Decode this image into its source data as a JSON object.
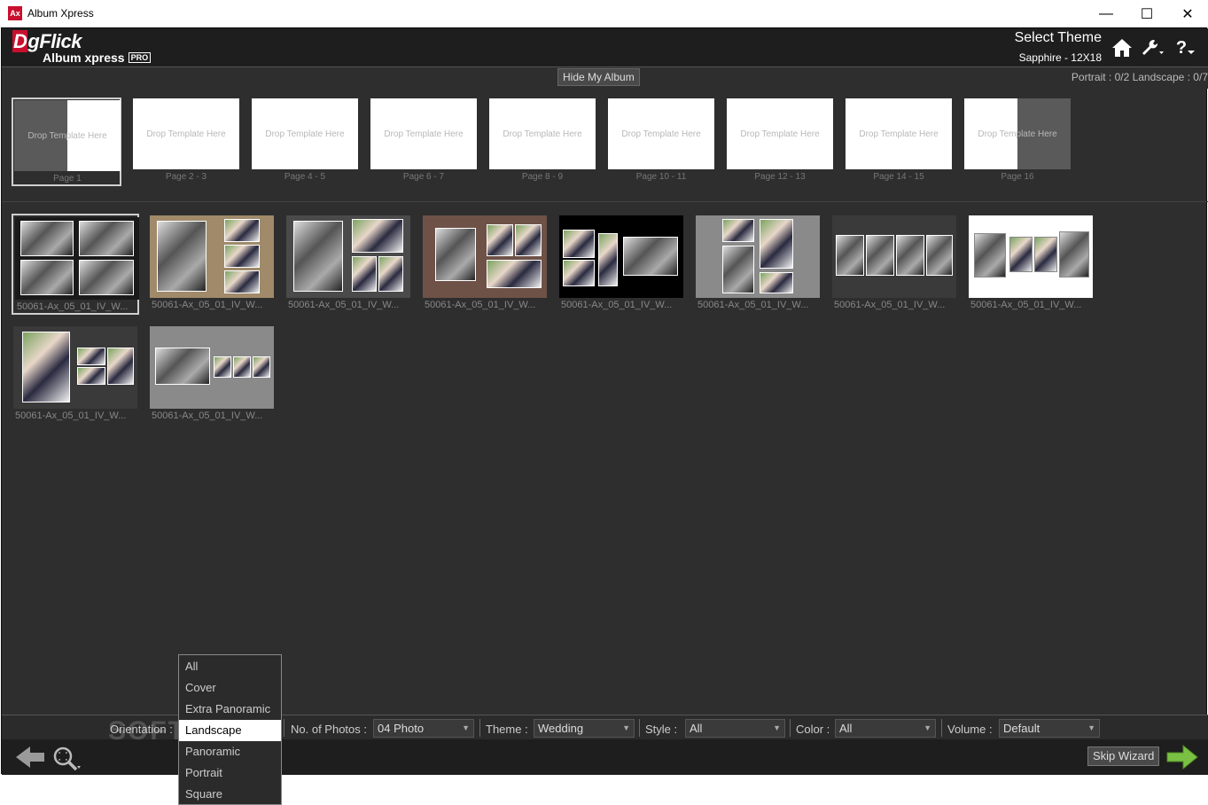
{
  "window": {
    "title": "Album Xpress",
    "icon_text": "Ax",
    "controls": [
      "—",
      "☐",
      "✕"
    ]
  },
  "header": {
    "logo_top_d": "D",
    "logo_top_rest": "gFlick",
    "logo_bottom": "Album xpress",
    "logo_badge": "PRO",
    "select_theme": "Select Theme",
    "theme_name": "Sapphire - 12X18",
    "icons": [
      "home-icon",
      "wrench-icon",
      "help-icon"
    ],
    "help_glyph": "?"
  },
  "subbar": {
    "hide_button": "Hide My Album",
    "counts": "Portrait :  0/2  Landscape :  0/7"
  },
  "pages": [
    {
      "placeholder": "Drop Template Here",
      "label": "Page 1"
    },
    {
      "placeholder": "Drop Template Here",
      "label": "Page 2 - 3"
    },
    {
      "placeholder": "Drop Template Here",
      "label": "Page 4 - 5"
    },
    {
      "placeholder": "Drop Template Here",
      "label": "Page 6 - 7"
    },
    {
      "placeholder": "Drop Template Here",
      "label": "Page 8 - 9"
    },
    {
      "placeholder": "Drop Template Here",
      "label": "Page 10 - 11"
    },
    {
      "placeholder": "Drop Template Here",
      "label": "Page 12 - 13"
    },
    {
      "placeholder": "Drop Template Here",
      "label": "Page 14 - 15"
    },
    {
      "placeholder": "Drop Template Here",
      "label": "Page 16"
    }
  ],
  "templates": [
    {
      "label": "50061-Ax_05_01_IV_W...",
      "bg": "#1a1a1a"
    },
    {
      "label": "50061-Ax_05_01_IV_W...",
      "bg": "#a08a6a"
    },
    {
      "label": "50061-Ax_05_01_IV_W...",
      "bg": "#4a4a4a"
    },
    {
      "label": "50061-Ax_05_01_IV_W...",
      "bg": "#6e5248"
    },
    {
      "label": "50061-Ax_05_01_IV_W...",
      "bg": "#000000"
    },
    {
      "label": "50061-Ax_05_01_IV_W...",
      "bg": "#8a8a8a"
    },
    {
      "label": "50061-Ax_05_01_IV_W...",
      "bg": "#3a3a3a"
    },
    {
      "label": "50061-Ax_05_01_IV_W...",
      "bg": "#ffffff"
    },
    {
      "label": "50061-Ax_05_01_IV_W...",
      "bg": "#3a3a3a"
    },
    {
      "label": "50061-Ax_05_01_IV_W...",
      "bg": "#8a8a8a"
    }
  ],
  "filters": {
    "orientation_label": "Orientation :",
    "photos_label": "No. of Photos :",
    "photos_value": "04 Photo",
    "theme_label": "Theme :",
    "theme_value": "Wedding",
    "style_label": "Style :",
    "style_value": "All",
    "color_label": "Color :",
    "color_value": "All",
    "volume_label": "Volume :",
    "volume_value": "Default",
    "arrow": "▼"
  },
  "orientation_options": [
    "All",
    "Cover",
    "Extra Panoramic",
    "Landscape",
    "Panoramic",
    "Portrait",
    "Square"
  ],
  "orientation_selected": "Landscape",
  "bottom": {
    "skip_button": "Skip Wizard"
  },
  "watermark": "SOFTPEDIA",
  "colors": {
    "accent_red": "#c8102e",
    "next_green": "#7ac143",
    "panel_bg": "#2e2e2e"
  }
}
